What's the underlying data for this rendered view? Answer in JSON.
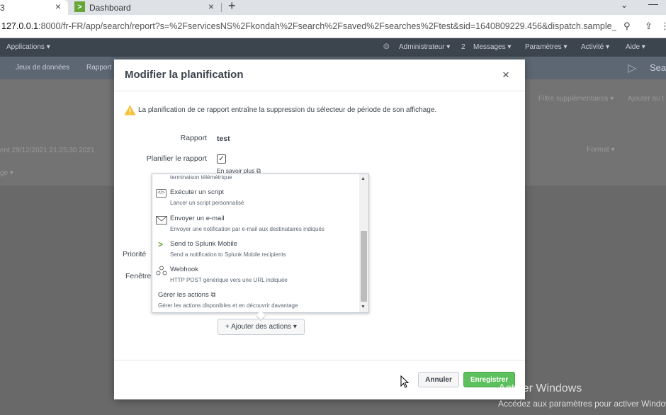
{
  "browser": {
    "tabs": [
      {
        "label": "3"
      },
      {
        "label": "Dashboard"
      }
    ],
    "url_host": "127.0.0.1",
    "url_rest": ":8000/fr-FR/app/search/report?s=%2FservicesNS%2Fkondah%2Fsearch%2Fsaved%2Fsearches%2Ftest&sid=1640809229.456&dispatch.sample_ra..."
  },
  "splunk_bar": {
    "apps": "Applications ▾",
    "admin": "Administrateur ▾",
    "messages_count": "2",
    "messages": "Messages ▾",
    "params": "Paramètres ▾",
    "activity": "Activité ▾",
    "help": "Aide ▾",
    "nav_datasets": "Jeux de données",
    "nav_reports": "Rapport",
    "nav_search": "Sea"
  },
  "background": {
    "extra_fields": "Filtre supplémentaires ▾",
    "add_to": "Ajouter au t",
    "date_range": "ent 29/12/2021 21:25:30 2021",
    "format": "Format ▾",
    "misc": "ge ▾"
  },
  "modal": {
    "title": "Modifier la planification",
    "close": "×",
    "warning": "La planification de ce rapport entraîne la suppression du sélecteur de période de son affichage.",
    "report_label": "Rapport",
    "report_value": "test",
    "schedule_label": "Planifier le rapport",
    "schedule_checked": "✓",
    "learn_more": "En savoir plus",
    "priority_label": "Priorité",
    "window_label": "Fenêtre",
    "add_actions": "+ Ajouter des actions ▾",
    "cancel": "Annuler",
    "save": "Enregistrer"
  },
  "dropdown": {
    "partial_item": "terminaison télémétrique",
    "items": [
      {
        "title": "Exécuter un script",
        "desc": "Lancer un script personnalisé",
        "icon": "script-icon"
      },
      {
        "title": "Envoyer un e-mail",
        "desc": "Envoyer une notification par e-mail aux destinataires indiqués",
        "icon": "envelope-icon"
      },
      {
        "title": "Send to Splunk Mobile",
        "desc": "Send a notification to Splunk Mobile recipients",
        "icon": "chevron-right-icon"
      },
      {
        "title": "Webhook",
        "desc": "HTTP POST générique vers une URL indiquée",
        "icon": "webhook-icon"
      }
    ],
    "manage_title": "Gérer les actions",
    "manage_desc": "Gérer les actions disponibles et en découvrir davantage"
  },
  "watermark": {
    "line1": "Activer Windows",
    "line2": "Accédez aux paramètres pour activer Windows."
  },
  "colors": {
    "splunk_green": "#65a637",
    "save_green": "#5cc05c",
    "warning_yellow": "#f8be34"
  }
}
